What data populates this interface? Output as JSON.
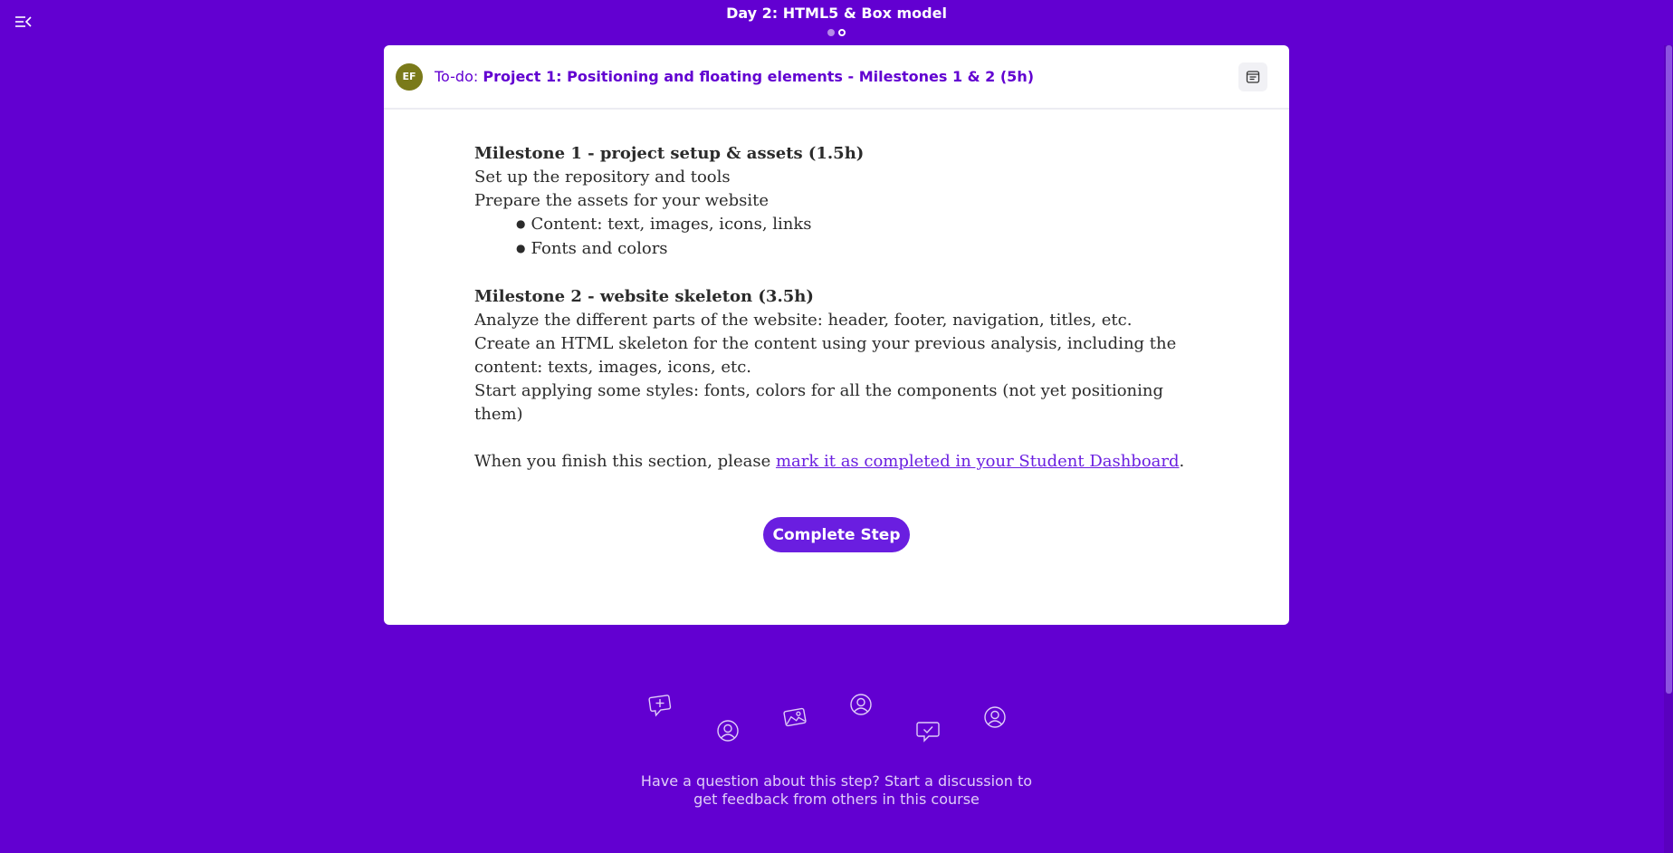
{
  "topbar": {
    "title": "Day 2: HTML5 & Box model",
    "menu_icon": "collapse-menu-icon"
  },
  "step_header": {
    "avatar_initials": "EF",
    "todo_prefix": "To-do:",
    "project_title": "Project 1: Positioning and floating elements - Milestones 1 & 2 (5h)",
    "notes_icon": "notes-icon"
  },
  "content": {
    "m1_title": "Milestone 1 - project setup & assets (1.5h)",
    "m1_line1": "Set up the repository and tools",
    "m1_line2": "Prepare the assets for your website",
    "m1_bullets": [
      "Content: text, images, icons, links",
      "Fonts and colors"
    ],
    "m2_title": "Milestone 2 - website skeleton (3.5h)",
    "m2_line1": "Analyze the different parts of the website: header, footer, navigation, titles, etc.",
    "m2_line2": "Create an HTML skeleton for the content using your previous analysis, including the content: texts, images, icons, etc.",
    "m2_line3": "Start applying some styles: fonts, colors for all the components (not yet positioning them)",
    "finish_prefix": "When you finish this section, please ",
    "finish_link": "mark it as completed in your Student Dashboard",
    "finish_suffix": "."
  },
  "complete_button": "Complete Step",
  "discussion": {
    "text": "Have a question about this step? Start a discussion to get feedback from others in this course",
    "icons": [
      "chat-plus-icon",
      "user-icon",
      "image-icon",
      "user-icon",
      "chat-check-icon",
      "user-icon"
    ]
  },
  "colors": {
    "background": "#6200d1",
    "accent": "#6a1ee0",
    "avatar": "#7a7a1a"
  }
}
